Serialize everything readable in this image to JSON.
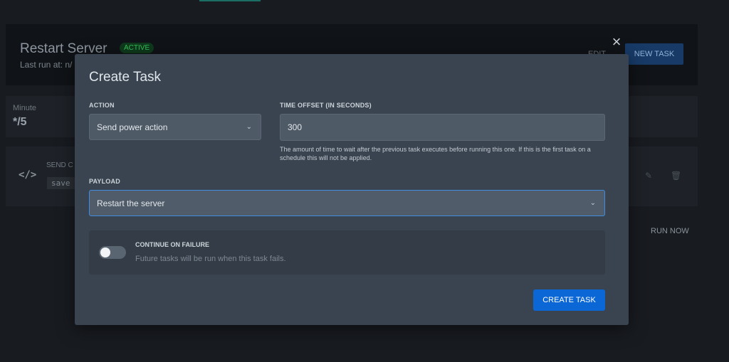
{
  "background": {
    "schedule_title": "Restart Server",
    "status_badge": "ACTIVE",
    "last_run": "Last run at: n/",
    "edit_label": "EDIT",
    "new_task_label": "NEW TASK",
    "cron": {
      "label": "Minute",
      "value": "*/5"
    },
    "task": {
      "label": "SEND C",
      "code": "save"
    },
    "run_now_label": "RUN NOW"
  },
  "modal": {
    "title": "Create Task",
    "action": {
      "label": "ACTION",
      "selected": "Send power action"
    },
    "time_offset": {
      "label": "TIME OFFSET (IN SECONDS)",
      "value": "300",
      "help": "The amount of time to wait after the previous task executes before running this one. If this is the first task on a schedule this will not be applied."
    },
    "payload": {
      "label": "PAYLOAD",
      "selected": "Restart the server"
    },
    "continue_on_failure": {
      "title": "CONTINUE ON FAILURE",
      "description": "Future tasks will be run when this task fails.",
      "enabled": false
    },
    "submit_label": "CREATE TASK"
  },
  "icons": {
    "close": "close-icon",
    "chevron": "chevron-down-icon",
    "code": "code-icon"
  },
  "colors": {
    "primary_button": "#0b67d6",
    "modal_bg": "#3a4450",
    "page_bg": "#181b20",
    "focus_border": "#3f8ce0",
    "active_badge": "#36c05a"
  }
}
